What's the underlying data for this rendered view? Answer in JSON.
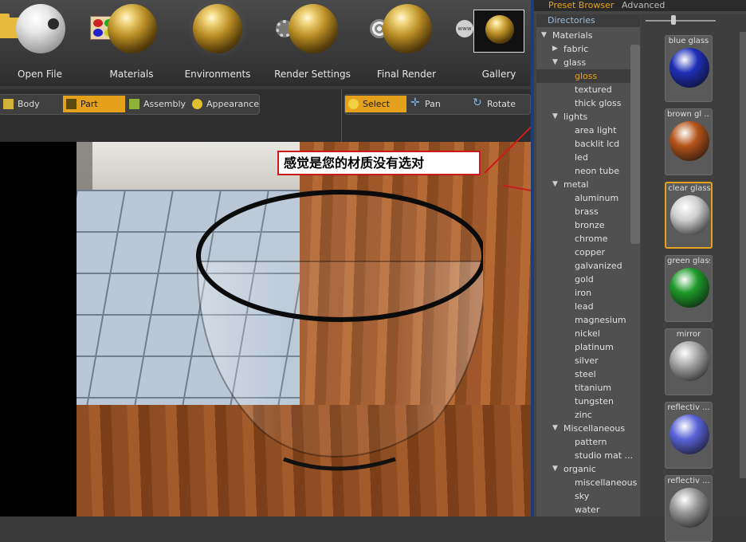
{
  "toolbar": {
    "items": [
      {
        "label": "Open File",
        "icon": "folder-icon"
      },
      {
        "label": "Materials",
        "icon": "materials-icon"
      },
      {
        "label": "Environments",
        "icon": "environment-sphere-icon"
      },
      {
        "label": "Render Settings",
        "icon": "gear-icon"
      },
      {
        "label": "Final Render",
        "icon": "render-target-icon"
      },
      {
        "label": "Gallery",
        "icon": "gallery-icon"
      }
    ],
    "www_glyph": "www"
  },
  "selection_modes": [
    {
      "label": "Body",
      "icon": "body-cube-icon",
      "active": false
    },
    {
      "label": "Part",
      "icon": "part-icon",
      "active": true
    },
    {
      "label": "Assembly",
      "icon": "assembly-icon",
      "active": false
    },
    {
      "label": "Appearance",
      "icon": "appearance-icon",
      "active": false
    }
  ],
  "navigation_modes": [
    {
      "label": "Select",
      "icon": "select-cursor-icon",
      "active": true
    },
    {
      "label": "Pan",
      "icon": "pan-arrows-icon",
      "active": false
    },
    {
      "label": "Rotate",
      "icon": "rotate-icon",
      "active": false
    }
  ],
  "annotation": {
    "text": "感觉是您的材质没有选对",
    "color": "#cc1a1a"
  },
  "right_panel": {
    "tabs": [
      {
        "label": "Preset Browser",
        "active": true
      },
      {
        "label": "Advanced",
        "active": false
      }
    ],
    "directories_header": "Directories",
    "tree": [
      {
        "label": "Materials",
        "level": 0,
        "toggle": "expanded"
      },
      {
        "label": "fabric",
        "level": 1,
        "toggle": "collapsed"
      },
      {
        "label": "glass",
        "level": 1,
        "toggle": "expanded"
      },
      {
        "label": "gloss",
        "level": 2,
        "selected": true
      },
      {
        "label": "textured",
        "level": 2
      },
      {
        "label": "thick gloss",
        "level": 2
      },
      {
        "label": "lights",
        "level": 1,
        "toggle": "expanded"
      },
      {
        "label": "area light",
        "level": 2
      },
      {
        "label": "backlit lcd",
        "level": 2
      },
      {
        "label": "led",
        "level": 2
      },
      {
        "label": "neon tube",
        "level": 2
      },
      {
        "label": "metal",
        "level": 1,
        "toggle": "expanded"
      },
      {
        "label": "aluminum",
        "level": 2
      },
      {
        "label": "brass",
        "level": 2
      },
      {
        "label": "bronze",
        "level": 2
      },
      {
        "label": "chrome",
        "level": 2
      },
      {
        "label": "copper",
        "level": 2
      },
      {
        "label": "galvanized",
        "level": 2
      },
      {
        "label": "gold",
        "level": 2
      },
      {
        "label": "iron",
        "level": 2
      },
      {
        "label": "lead",
        "level": 2
      },
      {
        "label": "magnesium",
        "level": 2
      },
      {
        "label": "nickel",
        "level": 2
      },
      {
        "label": "platinum",
        "level": 2
      },
      {
        "label": "silver",
        "level": 2
      },
      {
        "label": "steel",
        "level": 2
      },
      {
        "label": "titanium",
        "level": 2
      },
      {
        "label": "tungsten",
        "level": 2
      },
      {
        "label": "zinc",
        "level": 2
      },
      {
        "label": "Miscellaneous",
        "level": 1,
        "toggle": "expanded"
      },
      {
        "label": "pattern",
        "level": 2
      },
      {
        "label": "studio mat ...",
        "level": 2
      },
      {
        "label": "organic",
        "level": 1,
        "toggle": "expanded"
      },
      {
        "label": "miscellaneous",
        "level": 2
      },
      {
        "label": "sky",
        "level": 2
      },
      {
        "label": "water",
        "level": 2
      }
    ],
    "presets": [
      {
        "label": "blue glass",
        "color": "#1f2fb8",
        "selected": false
      },
      {
        "label": "brown gl ...",
        "color": "#b5541a",
        "selected": false
      },
      {
        "label": "clear glass",
        "color": "#cfcfcf",
        "selected": true
      },
      {
        "label": "green glass",
        "color": "#1e9a2a",
        "selected": false
      },
      {
        "label": "mirror",
        "color": "#a8a8a8",
        "selected": false
      },
      {
        "label": "reflectiv ...",
        "color": "#5a64d8",
        "selected": false
      },
      {
        "label": "reflectiv ...",
        "color": "#9a9a9a",
        "selected": false
      }
    ]
  }
}
